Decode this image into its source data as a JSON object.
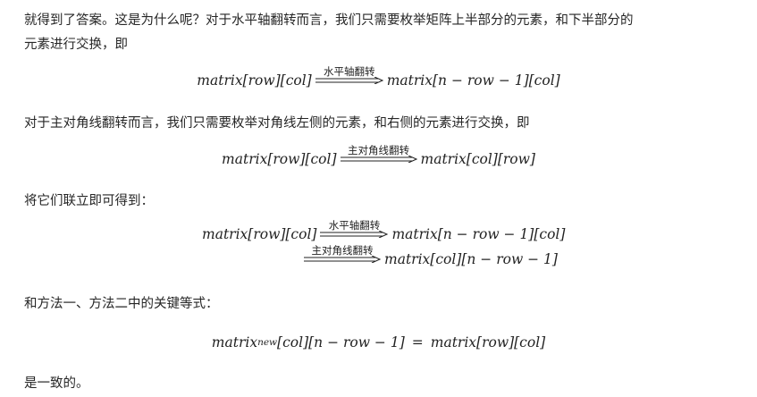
{
  "paragraphs": {
    "p1_line1": "就得到了答案。这是为什么呢？对于水平轴翻转而言，我们只需要枚举矩阵上半部分的元素，和下半部分的",
    "p1_line2": "元素进行交换，即",
    "p2": "对于主对角线翻转而言，我们只需要枚举对角线左侧的元素，和右侧的元素进行交换，即",
    "p3": "将它们联立即可得到：",
    "p4": "和方法一、方法二中的关键等式：",
    "p5": "是一致的。"
  },
  "equations": {
    "eq1": {
      "lhs": "matrix[row][col]",
      "arrow_label": "水平轴翻转",
      "rhs": "matrix[n − row − 1][col]"
    },
    "eq2": {
      "lhs": "matrix[row][col]",
      "arrow_label": "主对角线翻转",
      "rhs": "matrix[col][row]"
    },
    "eq3": {
      "lhs": "matrix[row][col]",
      "arrow1_label": "水平轴翻转",
      "mid": "matrix[n − row − 1][col]",
      "arrow2_label": "主对角线翻转",
      "rhs": "matrix[col][n − row − 1]"
    },
    "eq4": {
      "lhs_base": "matrix",
      "lhs_sub": "new",
      "lhs_rest": "[col][n − row − 1]",
      "equals": "=",
      "rhs": "matrix[row][col]"
    }
  }
}
